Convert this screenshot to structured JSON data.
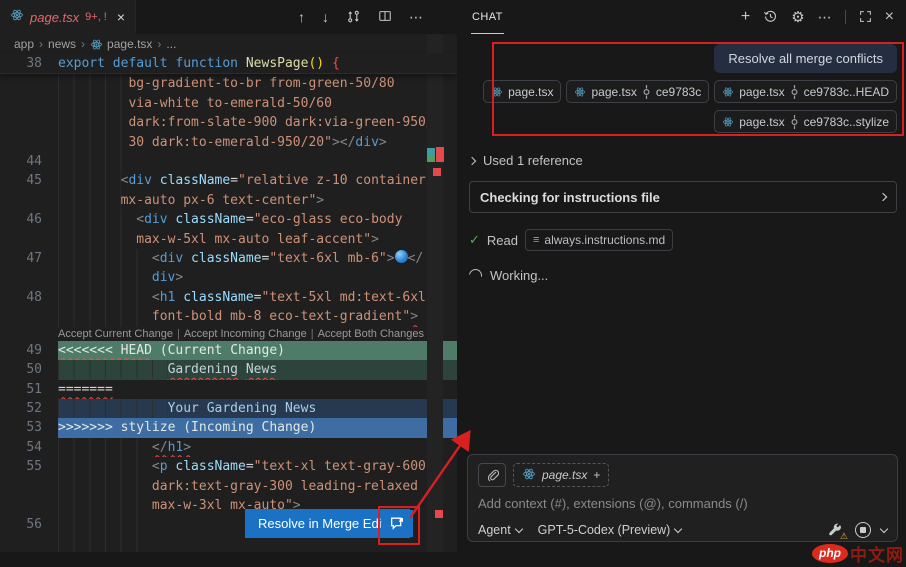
{
  "icons": {
    "chevron": "›",
    "close": "×",
    "plus": "+",
    "ellipsis": "⋯",
    "arrow_up": "↑",
    "arrow_down": "↓",
    "gear": "⚙",
    "warning": "⚠",
    "check": "✓",
    "md_file": "≡"
  },
  "colors": {
    "accent_blue": "#1b72c4",
    "annotation_red": "#d92020",
    "error_red": "#f14c4c",
    "react_blue": "#519aba",
    "check_green": "#57ab5a",
    "merge_current_header": "#4e7c69",
    "merge_current_content": "#2c443b",
    "merge_incoming_content": "#26394e",
    "merge_incoming_header": "#3e6da4"
  },
  "editor": {
    "tab": {
      "title": "page.tsx",
      "badge": "9+, !"
    },
    "breadcrumb": [
      {
        "label": "app"
      },
      {
        "label": "news"
      },
      {
        "label": "page.tsx",
        "icon": true
      },
      {
        "label": "..."
      }
    ],
    "sticky": {
      "num": "38",
      "segs": [
        [
          "tk",
          "export default function "
        ],
        [
          "tf",
          "NewsPage"
        ],
        [
          "tb",
          "()"
        ],
        [
          "tx",
          " "
        ],
        [
          "tr",
          "{"
        ]
      ]
    },
    "code": {
      "rows": [
        {
          "n": "",
          "i": 9,
          "s": [
            [
              "ts",
              "bg-gradient-to-br from-green-50/80"
            ]
          ]
        },
        {
          "n": "",
          "i": 9,
          "s": [
            [
              "ts",
              "via-white to-emerald-50/60"
            ]
          ]
        },
        {
          "n": "",
          "i": 9,
          "s": [
            [
              "ts",
              "dark:from-slate-900 dark:via-green-950/"
            ]
          ]
        },
        {
          "n": "",
          "i": 9,
          "s": [
            [
              "ts",
              "30 dark:to-emerald-950/20\""
            ],
            [
              "tp",
              "></"
            ],
            [
              "tt",
              "div"
            ],
            [
              "tp",
              ">"
            ]
          ]
        },
        {
          "n": "44",
          "i": 9,
          "s": []
        },
        {
          "n": "45",
          "i": 8,
          "s": [
            [
              "tp",
              "<"
            ],
            [
              "tt",
              "div"
            ],
            [
              "tx",
              " "
            ],
            [
              "ta",
              "className"
            ],
            [
              "to",
              "="
            ],
            [
              "ts",
              "\"relative z-10 container"
            ]
          ]
        },
        {
          "n": "",
          "i": 8,
          "s": [
            [
              "ts",
              "mx-auto px-6 text-center\""
            ],
            [
              "tp",
              ">"
            ]
          ]
        },
        {
          "n": "46",
          "i": 10,
          "s": [
            [
              "tp",
              "<"
            ],
            [
              "tt",
              "div"
            ],
            [
              "tx",
              " "
            ],
            [
              "ta",
              "className"
            ],
            [
              "to",
              "="
            ],
            [
              "ts",
              "\"eco-glass eco-body"
            ]
          ]
        },
        {
          "n": "",
          "i": 10,
          "s": [
            [
              "ts",
              "max-w-5xl mx-auto leaf-accent\""
            ],
            [
              "tp",
              ">"
            ]
          ]
        },
        {
          "n": "47",
          "i": 12,
          "s": [
            [
              "tp",
              "<"
            ],
            [
              "tt",
              "div"
            ],
            [
              "tx",
              " "
            ],
            [
              "ta",
              "className"
            ],
            [
              "to",
              "="
            ],
            [
              "ts",
              "\"text-6xl mb-6\""
            ],
            [
              "tp",
              ">"
            ],
            [
              "globe",
              ""
            ],
            [
              "tp",
              "</"
            ]
          ]
        },
        {
          "n": "",
          "i": 12,
          "s": [
            [
              "tt",
              "div"
            ],
            [
              "tp",
              ">"
            ]
          ]
        },
        {
          "n": "48",
          "i": 12,
          "s": [
            [
              "tp",
              "<"
            ],
            [
              "tt",
              "h1"
            ],
            [
              "tx",
              " "
            ],
            [
              "ta",
              "className"
            ],
            [
              "to",
              "="
            ],
            [
              "ts",
              "\"text-5xl md:text-6xl"
            ]
          ]
        },
        {
          "n": "",
          "i": 12,
          "s": [
            [
              "ts",
              "font-bold mb-8 eco-text-gradient\""
            ],
            [
              "tp",
              ">",
              1
            ]
          ],
          "lensAfter": true
        },
        {
          "n": "49",
          "i": 0,
          "bg": "ch",
          "s": [
            [
              "tm",
              "<<<<<<< HEAD",
              1
            ],
            [
              "tm",
              " (Current Change)"
            ]
          ]
        },
        {
          "n": "50",
          "i": 14,
          "bg": "cb",
          "s": [
            [
              "tc1",
              "Gardening",
              1
            ],
            [
              "tc1",
              " "
            ],
            [
              "tc1",
              "News",
              1
            ]
          ]
        },
        {
          "n": "51",
          "i": 0,
          "s": [
            [
              "tx",
              "=======",
              1
            ]
          ]
        },
        {
          "n": "52",
          "i": 14,
          "bg": "ib",
          "s": [
            [
              "tc2",
              "Your Gardening News"
            ]
          ]
        },
        {
          "n": "53",
          "i": 0,
          "bg": "ih",
          "s": [
            [
              "tm",
              ">>>>>>> stylize (Incoming Change)"
            ]
          ]
        },
        {
          "n": "54",
          "i": 12,
          "s": [
            [
              "tp",
              "</",
              1
            ],
            [
              "tt",
              "h1",
              1
            ],
            [
              "tp",
              ">",
              1
            ]
          ]
        },
        {
          "n": "55",
          "i": 12,
          "s": [
            [
              "tp",
              "<"
            ],
            [
              "tt",
              "p"
            ],
            [
              "tx",
              " "
            ],
            [
              "ta",
              "className"
            ],
            [
              "to",
              "="
            ],
            [
              "ts",
              "\"text-xl text-gray-600"
            ]
          ]
        },
        {
          "n": "",
          "i": 12,
          "s": [
            [
              "ts",
              "dark:text-gray-300 leading-relaxed"
            ]
          ]
        },
        {
          "n": "",
          "i": 12,
          "s": [
            [
              "ts",
              "max-w-3xl mx-auto\""
            ],
            [
              "tp",
              ">"
            ]
          ]
        },
        {
          "n": "56",
          "i": 12,
          "s": []
        },
        {
          "n": "",
          "i": 12,
          "s": []
        }
      ]
    },
    "codelens": {
      "actions": [
        "Accept Current Change",
        "Accept Incoming Change",
        "Accept Both Changes"
      ],
      "separator": "|"
    },
    "resolve_button": {
      "label": "Resolve in Merge Editor"
    }
  },
  "chat": {
    "panel_title": "CHAT",
    "request": "Resolve all merge conflicts",
    "attachments_row1": [
      {
        "name": "page.tsx"
      },
      {
        "name": "page.tsx",
        "ref": "ce9783c"
      },
      {
        "name": "page.tsx",
        "ref": "ce9783c..HEAD"
      }
    ],
    "attachments_row2": [
      {
        "name": "page.tsx",
        "ref": "ce9783c..stylize"
      }
    ],
    "used_reference": "Used 1 reference",
    "tool_call": "Checking for instructions file",
    "read_label": "Read",
    "read_file": "always.instructions.md",
    "working": "Working...",
    "input": {
      "context_chip": "page.tsx",
      "chip_add": "+",
      "placeholder": "Add context (#), extensions (@), commands (/)",
      "mode": "Agent",
      "model": "GPT-5-Codex (Preview)"
    }
  },
  "watermark": {
    "badge": "php",
    "text": "中文网"
  }
}
